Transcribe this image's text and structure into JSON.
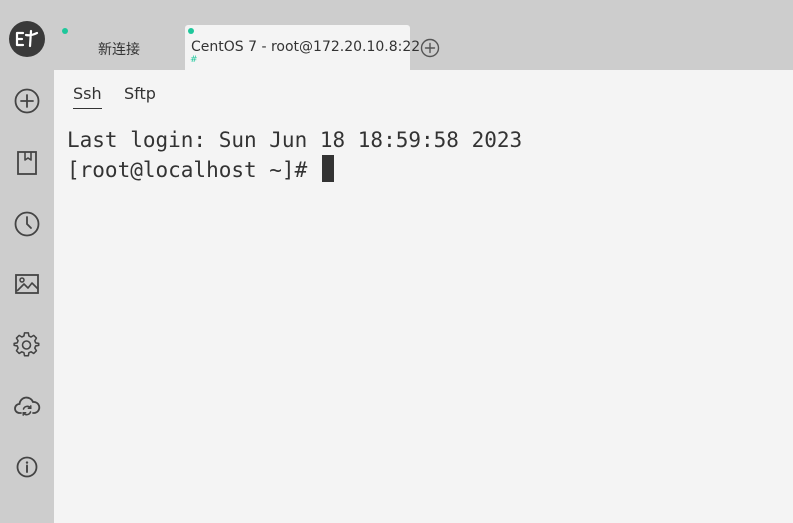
{
  "sidebar": {
    "logo_text": "ET",
    "items": [
      {
        "icon": "add-circle-icon"
      },
      {
        "icon": "bookmark-icon"
      },
      {
        "icon": "clock-icon"
      },
      {
        "icon": "image-icon"
      },
      {
        "icon": "gear-icon"
      },
      {
        "icon": "cloud-sync-icon"
      },
      {
        "icon": "info-icon"
      }
    ]
  },
  "tabs": [
    {
      "label": "新连接",
      "active": false
    },
    {
      "label": "CentOS 7 - root@172.20.10.8:22",
      "active": true,
      "marker": "#"
    }
  ],
  "subtabs": [
    {
      "label": "Ssh",
      "active": true
    },
    {
      "label": "Sftp",
      "active": false
    }
  ],
  "terminal": {
    "lines": [
      "Last login: Sun Jun 18 18:59:58 2023",
      "[root@localhost ~]# "
    ]
  },
  "colors": {
    "sidebar_bg": "#cdcdcd",
    "content_bg": "#f4f4f4",
    "status_dot": "#1ec79b",
    "text": "#333333"
  }
}
